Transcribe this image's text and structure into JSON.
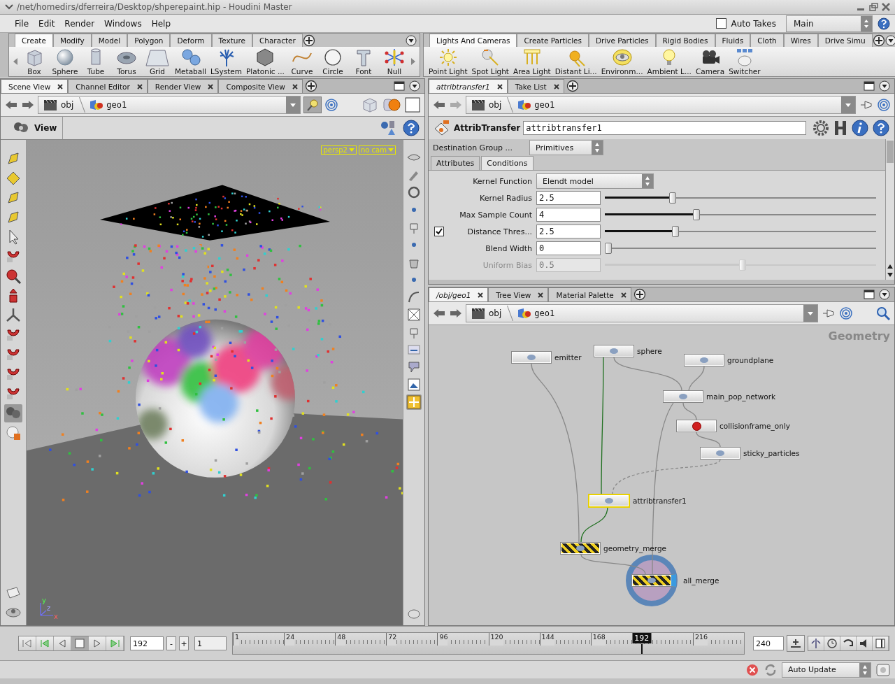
{
  "window": {
    "title": "/net/homedirs/dferreira/Desktop/shperepaint.hip - Houdini Master"
  },
  "menu": [
    "File",
    "Edit",
    "Render",
    "Windows",
    "Help"
  ],
  "auto_takes": {
    "label": "Auto Takes",
    "checked": false
  },
  "take_menu": {
    "value": "Main"
  },
  "shelves": [
    {
      "tabs": [
        {
          "label": "Create",
          "selected": true
        },
        {
          "label": "Modify",
          "selected": false
        },
        {
          "label": "Model",
          "selected": false
        },
        {
          "label": "Polygon",
          "selected": false
        },
        {
          "label": "Deform",
          "selected": false
        },
        {
          "label": "Texture",
          "selected": false
        },
        {
          "label": "Character",
          "selected": false
        }
      ],
      "tools": [
        {
          "kind": "box",
          "label": "Box"
        },
        {
          "kind": "sphere",
          "label": "Sphere"
        },
        {
          "kind": "tube",
          "label": "Tube"
        },
        {
          "kind": "torus",
          "label": "Torus"
        },
        {
          "kind": "grid",
          "label": "Grid"
        },
        {
          "kind": "metaball",
          "label": "Metaball"
        },
        {
          "kind": "lsystem",
          "label": "LSystem"
        },
        {
          "kind": "platonic",
          "label": "Platonic ..."
        },
        {
          "kind": "curve",
          "label": "Curve"
        },
        {
          "kind": "circle",
          "label": "Circle"
        },
        {
          "kind": "font",
          "label": "Font"
        },
        {
          "kind": "null",
          "label": "Null"
        }
      ]
    },
    {
      "tabs": [
        {
          "label": "Lights And Cameras",
          "selected": true
        },
        {
          "label": "Create Particles",
          "selected": false
        },
        {
          "label": "Drive Particles",
          "selected": false
        },
        {
          "label": "Rigid Bodies",
          "selected": false
        },
        {
          "label": "Fluids",
          "selected": false
        },
        {
          "label": "Cloth",
          "selected": false
        },
        {
          "label": "Wires",
          "selected": false
        },
        {
          "label": "Drive Simu",
          "selected": false
        }
      ],
      "tools": [
        {
          "kind": "light",
          "label": "Point Light"
        },
        {
          "kind": "spot",
          "label": "Spot Light"
        },
        {
          "kind": "area",
          "label": "Area Light"
        },
        {
          "kind": "sun",
          "label": "Distant Li..."
        },
        {
          "kind": "env",
          "label": "Environm..."
        },
        {
          "kind": "bulb",
          "label": "Ambient L..."
        },
        {
          "kind": "camera",
          "label": "Camera"
        },
        {
          "kind": "switcher",
          "label": "Switcher"
        }
      ]
    }
  ],
  "scene_pane": {
    "tabs": [
      {
        "label": "Scene View",
        "selected": true
      },
      {
        "label": "Channel Editor",
        "selected": false
      },
      {
        "label": "Render View",
        "selected": false
      },
      {
        "label": "Composite View",
        "selected": false
      }
    ],
    "path": [
      "obj",
      "geo1"
    ],
    "view_label": "View",
    "camera_menus": [
      "persp2",
      "no cam"
    ],
    "axis_labels": [
      "y",
      "x",
      "z"
    ]
  },
  "parameter_pane": {
    "tabs": [
      {
        "label": "attribtransfer1",
        "selected": true
      },
      {
        "label": "Take List",
        "selected": false
      }
    ],
    "path": [
      "obj",
      "geo1"
    ],
    "node_type": "AttribTransfer",
    "node_name": "attribtransfer1",
    "destination_group": {
      "label": "Destination Group ...",
      "value": "Primitives"
    },
    "sections": [
      {
        "label": "Attributes",
        "selected": false
      },
      {
        "label": "Conditions",
        "selected": true
      }
    ],
    "params": [
      {
        "kind": "menu",
        "label": "Kernel Function",
        "value": "Elendt model",
        "disabled": false
      },
      {
        "kind": "slider",
        "label": "Kernel Radius",
        "value": "2.5",
        "level": 0.24,
        "disabled": false
      },
      {
        "kind": "slider",
        "label": "Max Sample Count",
        "value": "4",
        "level": 0.33,
        "disabled": false
      },
      {
        "kind": "slider",
        "label": "Distance Thres...",
        "value": "2.5",
        "level": 0.25,
        "disabled": false,
        "toggle": {
          "checked": true
        }
      },
      {
        "kind": "slider",
        "label": "Blend Width",
        "value": "0",
        "level": 0,
        "disabled": false
      },
      {
        "kind": "slider",
        "label": "Uniform Bias",
        "value": "0.5",
        "level": 0.5,
        "disabled": true
      }
    ]
  },
  "network_pane": {
    "tabs": [
      {
        "label": "/obj/geo1",
        "selected": true
      },
      {
        "label": "Tree View",
        "selected": false
      },
      {
        "label": "Material Palette",
        "selected": false
      }
    ],
    "path": [
      "obj",
      "geo1"
    ],
    "context_label": "Geometry",
    "nodes": [
      {
        "name": "emitter",
        "selected": false,
        "display": false,
        "bypass": false,
        "striped": false
      },
      {
        "name": "sphere",
        "selected": false,
        "display": false,
        "bypass": false,
        "striped": false
      },
      {
        "name": "groundplane",
        "selected": false,
        "display": false,
        "bypass": false,
        "striped": false
      },
      {
        "name": "main_pop_network",
        "selected": false,
        "display": false,
        "bypass": false,
        "striped": false
      },
      {
        "name": "collisionframe_only",
        "selected": false,
        "display": false,
        "bypass": true,
        "striped": false
      },
      {
        "name": "sticky_particles",
        "selected": false,
        "display": false,
        "bypass": false,
        "striped": false
      },
      {
        "name": "attribtransfer1",
        "selected": true,
        "display": false,
        "bypass": false,
        "striped": false
      },
      {
        "name": "geometry_merge",
        "selected": false,
        "display": false,
        "bypass": false,
        "striped": true
      },
      {
        "name": "all_merge",
        "selected": false,
        "display": true,
        "bypass": false,
        "striped": true
      }
    ]
  },
  "timeline": {
    "frame": "192",
    "step_buttons": [
      "-",
      "+"
    ],
    "start": "1",
    "ticks": [
      "1",
      "24",
      "48",
      "72",
      "96",
      "120",
      "144",
      "168",
      "216"
    ],
    "current": "192",
    "level": 0.8,
    "end": "240"
  },
  "status_bar": {
    "update_mode": "Auto Update"
  }
}
